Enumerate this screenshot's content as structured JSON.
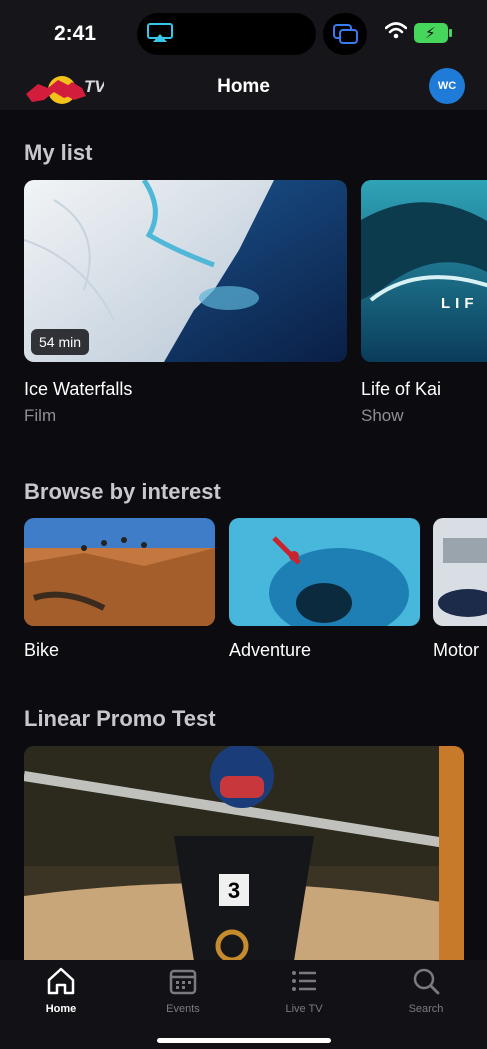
{
  "status_bar": {
    "time": "2:41"
  },
  "header": {
    "title": "Home",
    "avatar_initials": "WC",
    "logo_text": "TV"
  },
  "my_list": {
    "title": "My list",
    "items": [
      {
        "title": "Ice Waterfalls",
        "type": "Film",
        "duration": "54 min"
      },
      {
        "title": "Life of Kai",
        "type": "Show",
        "overlay_text": "LIF"
      }
    ]
  },
  "browse": {
    "title": "Browse by interest",
    "items": [
      {
        "label": "Bike"
      },
      {
        "label": "Adventure"
      },
      {
        "label": "Motor"
      }
    ]
  },
  "promo": {
    "title": "Linear Promo Test",
    "bib_number": "3"
  },
  "tabs": [
    {
      "label": "Home",
      "icon": "home-icon",
      "active": true
    },
    {
      "label": "Events",
      "icon": "calendar-icon",
      "active": false
    },
    {
      "label": "Live TV",
      "icon": "list-icon",
      "active": false
    },
    {
      "label": "Search",
      "icon": "search-icon",
      "active": false
    }
  ],
  "colors": {
    "accent_blue": "#1f7bd8",
    "battery_green": "#47d65c",
    "background": "#0b0b10"
  }
}
